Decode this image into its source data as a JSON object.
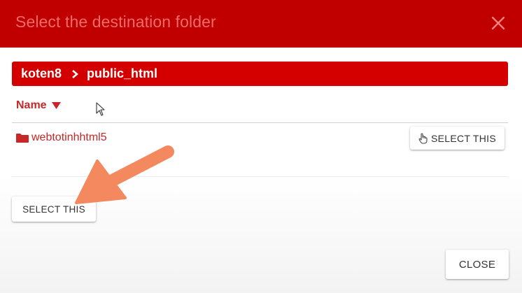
{
  "dialog": {
    "title": "Select the destination folder",
    "close_icon": "close-icon"
  },
  "breadcrumb": {
    "items": [
      {
        "label": "koten8"
      },
      {
        "label": "public_html"
      }
    ],
    "separator_icon": "chevron-right-icon"
  },
  "file_list": {
    "column_header": "Name",
    "sort_icon": "sort-desc-icon",
    "rows": [
      {
        "icon": "folder-icon",
        "name": "webtotinhhtml5",
        "action_icon": "hand-pointer-icon",
        "action_label": "SELECT THIS"
      }
    ]
  },
  "footer": {
    "select_label": "SELECT THIS",
    "close_label": "CLOSE"
  },
  "colors": {
    "header_bg": "#c00000",
    "title_text": "#ef6a6a",
    "breadcrumb_bg": "#d40000",
    "link_text": "#c62828",
    "annotation_arrow": "#f4895f"
  }
}
